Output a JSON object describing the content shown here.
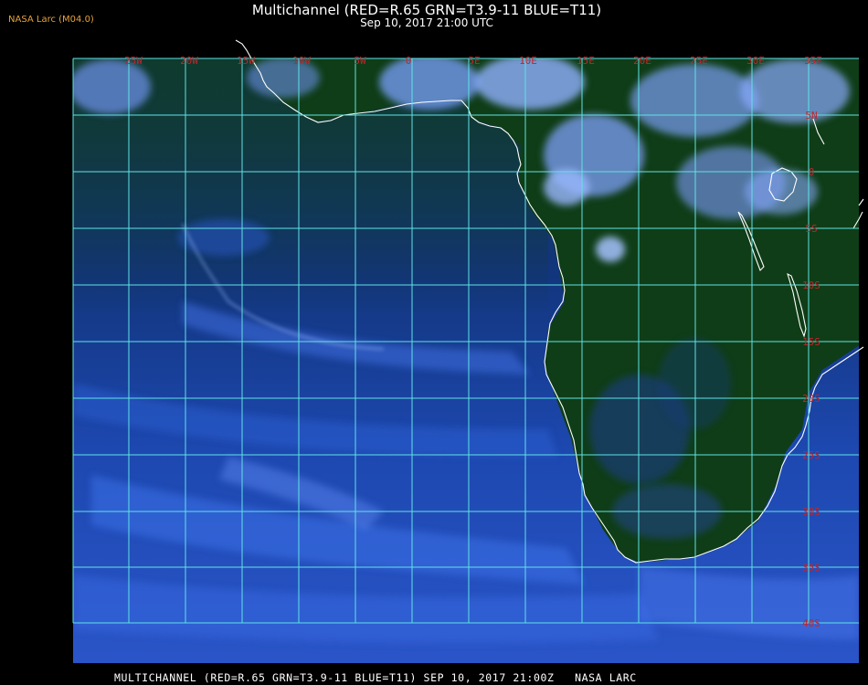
{
  "header": {
    "badge": "NASA Larc (M04.0)",
    "title": "Multichannel (RED=R.65 GRN=T3.9-11 BLUE=T11)",
    "subtitle": "Sep 10, 2017 21:00 UTC"
  },
  "footer": {
    "text": "MULTICHANNEL (RED=R.65 GRN=T3.9-11 BLUE=T11) SEP 10, 2017 21:00Z   NASA LARC"
  },
  "grid": {
    "longitude_labels": [
      "25W",
      "20W",
      "15W",
      "10W",
      "5W",
      "0",
      "5E",
      "10E",
      "15E",
      "20E",
      "25E",
      "30E",
      "35E"
    ],
    "latitude_labels": [
      "5N",
      "0",
      "5S",
      "10S",
      "15S",
      "20S",
      "25S",
      "30S",
      "35S",
      "40S"
    ]
  },
  "colors": {
    "grid_line": "#5fe3e6",
    "grid_label": "#c0262c",
    "coastline": "#ffffff",
    "ocean": "#1c46a8",
    "land": "#0f3a14",
    "cloud": "#7aa8ff",
    "badge": "#e8a23a"
  }
}
